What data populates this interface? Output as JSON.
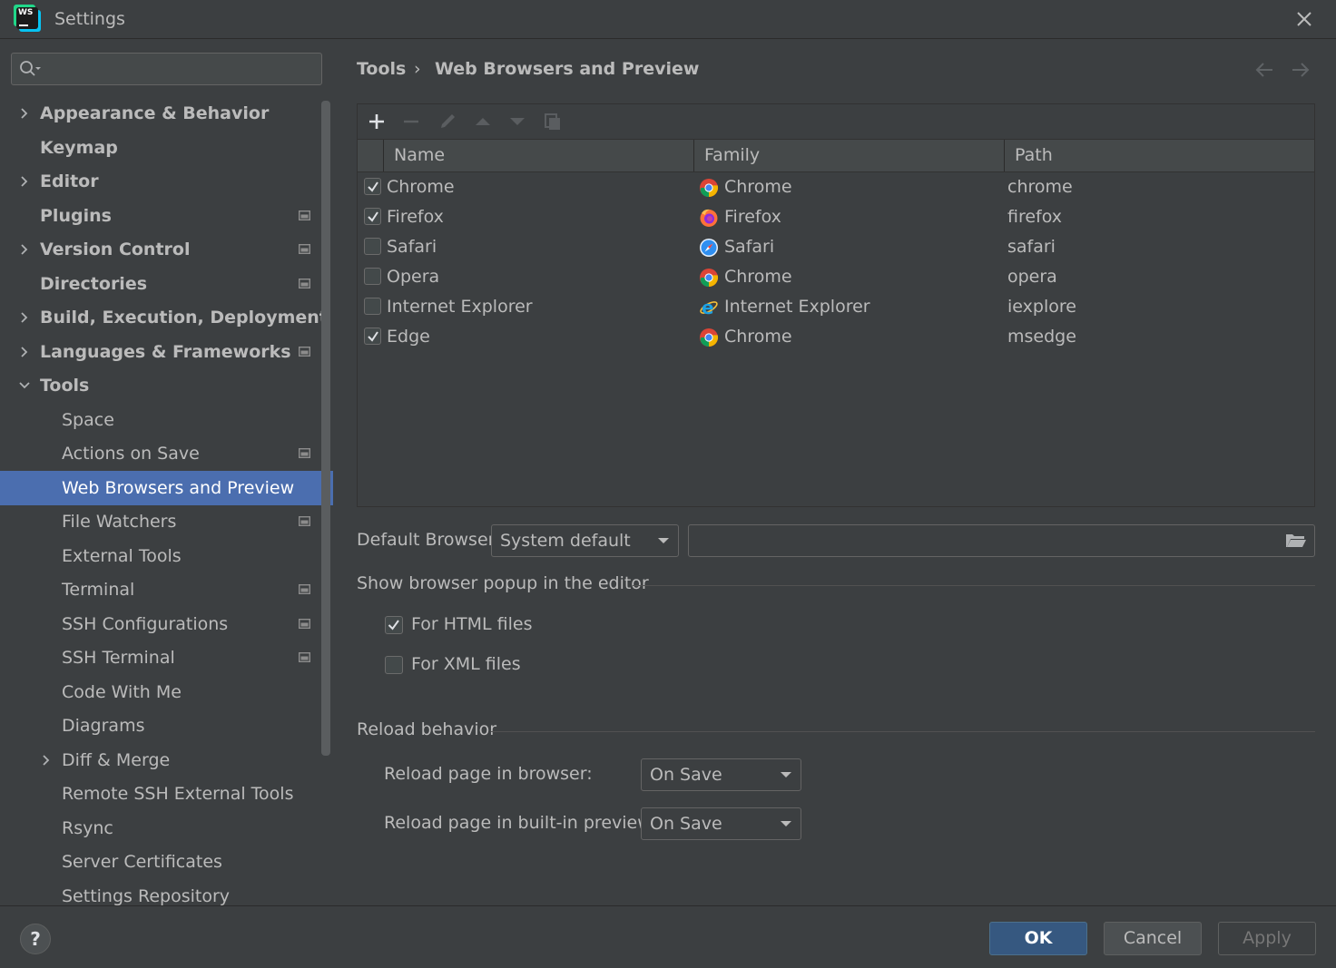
{
  "window": {
    "title": "Settings"
  },
  "search": {
    "placeholder": "",
    "value": ""
  },
  "sidebar": {
    "items": [
      {
        "label": "Appearance & Behavior",
        "level": 0,
        "expandable": true,
        "expanded": false,
        "bold": true,
        "project_icon": false
      },
      {
        "label": "Keymap",
        "level": 0,
        "expandable": false,
        "bold": true,
        "project_icon": false
      },
      {
        "label": "Editor",
        "level": 0,
        "expandable": true,
        "expanded": false,
        "bold": true,
        "project_icon": false
      },
      {
        "label": "Plugins",
        "level": 0,
        "expandable": false,
        "bold": true,
        "project_icon": true
      },
      {
        "label": "Version Control",
        "level": 0,
        "expandable": true,
        "expanded": false,
        "bold": true,
        "project_icon": true
      },
      {
        "label": "Directories",
        "level": 0,
        "expandable": false,
        "bold": true,
        "project_icon": true
      },
      {
        "label": "Build, Execution, Deployment",
        "level": 0,
        "expandable": true,
        "expanded": false,
        "bold": true,
        "project_icon": false
      },
      {
        "label": "Languages & Frameworks",
        "level": 0,
        "expandable": true,
        "expanded": false,
        "bold": true,
        "project_icon": true
      },
      {
        "label": "Tools",
        "level": 0,
        "expandable": true,
        "expanded": true,
        "bold": true,
        "project_icon": false
      },
      {
        "label": "Space",
        "level": 1,
        "expandable": false,
        "project_icon": false
      },
      {
        "label": "Actions on Save",
        "level": 1,
        "expandable": false,
        "project_icon": true
      },
      {
        "label": "Web Browsers and Preview",
        "level": 1,
        "expandable": false,
        "project_icon": false,
        "selected": true
      },
      {
        "label": "File Watchers",
        "level": 1,
        "expandable": false,
        "project_icon": true
      },
      {
        "label": "External Tools",
        "level": 1,
        "expandable": false,
        "project_icon": false
      },
      {
        "label": "Terminal",
        "level": 1,
        "expandable": false,
        "project_icon": true
      },
      {
        "label": "SSH Configurations",
        "level": 1,
        "expandable": false,
        "project_icon": true
      },
      {
        "label": "SSH Terminal",
        "level": 1,
        "expandable": false,
        "project_icon": true
      },
      {
        "label": "Code With Me",
        "level": 1,
        "expandable": false,
        "project_icon": false
      },
      {
        "label": "Diagrams",
        "level": 1,
        "expandable": false,
        "project_icon": false
      },
      {
        "label": "Diff & Merge",
        "level": 1,
        "expandable": true,
        "expanded": false,
        "project_icon": false
      },
      {
        "label": "Remote SSH External Tools",
        "level": 1,
        "expandable": false,
        "project_icon": false
      },
      {
        "label": "Rsync",
        "level": 1,
        "expandable": false,
        "project_icon": false
      },
      {
        "label": "Server Certificates",
        "level": 1,
        "expandable": false,
        "project_icon": false
      },
      {
        "label": "Settings Repository",
        "level": 1,
        "expandable": false,
        "project_icon": false
      }
    ]
  },
  "breadcrumb": {
    "root": "Tools",
    "separator": "›",
    "page": "Web Browsers and Preview"
  },
  "toolbar": {
    "buttons": [
      "add-icon",
      "remove-icon",
      "edit-icon",
      "move-up-icon",
      "move-down-icon",
      "copy-icon"
    ]
  },
  "table": {
    "columns": [
      "Name",
      "Family",
      "Path"
    ],
    "rows": [
      {
        "checked": true,
        "name": "Chrome",
        "family": "Chrome",
        "family_icon": "chrome-icon",
        "path": "chrome"
      },
      {
        "checked": true,
        "name": "Firefox",
        "family": "Firefox",
        "family_icon": "firefox-icon",
        "path": "firefox"
      },
      {
        "checked": false,
        "name": "Safari",
        "family": "Safari",
        "family_icon": "safari-icon",
        "path": "safari"
      },
      {
        "checked": false,
        "name": "Opera",
        "family": "Chrome",
        "family_icon": "chrome-icon",
        "path": "opera"
      },
      {
        "checked": false,
        "name": "Internet Explorer",
        "family": "Internet Explorer",
        "family_icon": "ie-icon",
        "path": "iexplore"
      },
      {
        "checked": true,
        "name": "Edge",
        "family": "Chrome",
        "family_icon": "chrome-icon",
        "path": "msedge"
      }
    ]
  },
  "default_browser": {
    "label": "Default Browser:",
    "value": "System default",
    "path_value": ""
  },
  "popup_section": {
    "title": "Show browser popup in the editor",
    "options": [
      {
        "label": "For HTML files",
        "checked": true
      },
      {
        "label": "For XML files",
        "checked": false
      }
    ]
  },
  "reload_section": {
    "title": "Reload behavior",
    "browser_label": "Reload page in browser:",
    "browser_value": "On Save",
    "preview_label": "Reload page in built-in preview:",
    "preview_value": "On Save"
  },
  "buttons": {
    "help": "?",
    "ok": "OK",
    "cancel": "Cancel",
    "apply": "Apply"
  },
  "colors": {
    "accent": "#4b6eaf",
    "background": "#3c3f41",
    "ok_button": "#365880"
  }
}
